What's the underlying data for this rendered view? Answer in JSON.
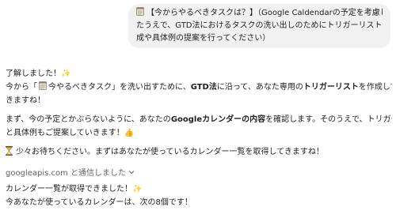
{
  "user_message": {
    "line1_title": "【今からやるべきタスクは？】（Google Caldendarの予定を考慮し",
    "line2": "たうえで、GTD法におけるタスクの洗い出しのためにトリガーリストの作",
    "line3": "成や具体例の提案を行ってください）"
  },
  "assistant": {
    "p1_a": "了解しました！",
    "p1_sparkle": "✨",
    "p2_a": "今から「",
    "p2_b": "今やるべきタスク」を洗い出すために、",
    "p2_bold1": "GTD法",
    "p2_c": "に沿って、あなた専用の",
    "p2_bold2": "トリガーリスト",
    "p2_d": "を作成してい",
    "p3": "きますね！",
    "p4_a": "まず、今の予定とかぶらないように、あなたの",
    "p4_bold": "Googleカレンダーの内容",
    "p4_b": "を確認します。そのうえで、トリガーリスト",
    "p5_a": "と具体例もご提案していきます！",
    "p5_emoji": "👍",
    "p6": "少々お待ちください。まずはあなたが使っているカレンダー一覧を取得してきますね！",
    "tool_label": "googleapis.com と通信しました",
    "p7_a": "カレンダー一覧が取得できました！",
    "p7_sparkle": "✨",
    "p8": "今あなたが使っているカレンダーは、次の8個です！"
  },
  "icons": {
    "notepad": "notepad-icon",
    "hourglass": "hourglass-icon",
    "chevron": "chevron-down-icon",
    "sparkle": "sparkle-icon"
  },
  "colors": {
    "bubble": "#f1f1f1",
    "text": "#1f1f1f",
    "muted": "#5f6368",
    "sparkle": "#f5c518"
  }
}
